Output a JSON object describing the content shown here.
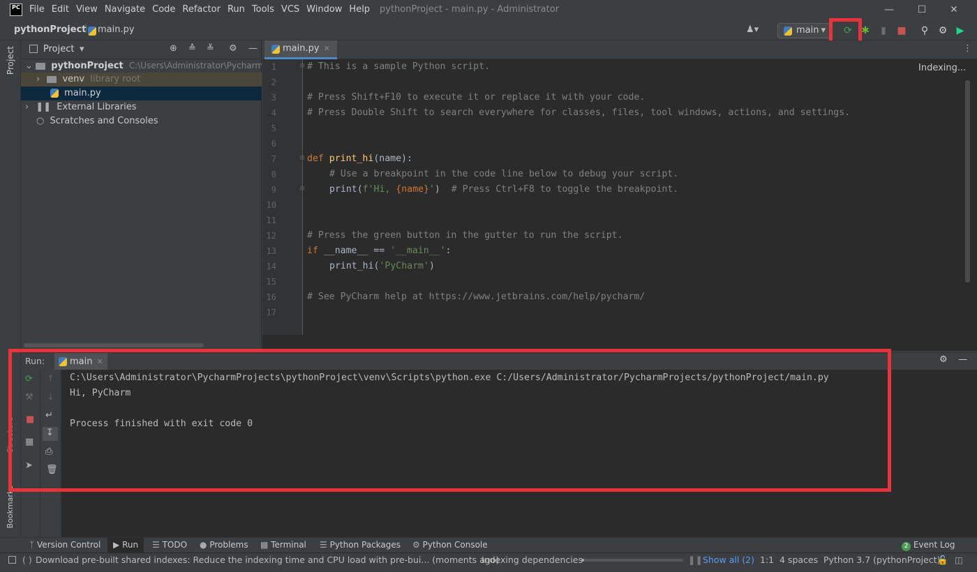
{
  "app": {
    "logo_text": "PC",
    "window_title": "pythonProject - main.py - Administrator"
  },
  "menu": [
    "File",
    "Edit",
    "View",
    "Navigate",
    "Code",
    "Refactor",
    "Run",
    "Tools",
    "VCS",
    "Window",
    "Help"
  ],
  "navbar": {
    "project": "pythonProject",
    "file": "main.py",
    "run_config": "main"
  },
  "project_panel": {
    "title": "Project",
    "stripe_label": "Project",
    "tree": [
      {
        "label": "pythonProject",
        "hint": "C:\\Users\\Administrator\\PycharmProjects\\pythonProject"
      },
      {
        "label": "venv",
        "hint": "library root"
      },
      {
        "label": "main.py",
        "hint": ""
      },
      {
        "label": "External Libraries",
        "hint": ""
      },
      {
        "label": "Scratches and Consoles",
        "hint": ""
      }
    ]
  },
  "editor": {
    "tab": "main.py",
    "status": "Indexing...",
    "line_numbers": [
      "1",
      "2",
      "3",
      "4",
      "5",
      "6",
      "7",
      "8",
      "9",
      "10",
      "11",
      "12",
      "13",
      "14",
      "15",
      "16",
      "17"
    ],
    "lines": {
      "l1": "# This is a sample Python script.",
      "l3": "# Press Shift+F10 to execute it or replace it with your code.",
      "l4": "# Press Double Shift to search everywhere for classes, files, tool windows, actions, and settings.",
      "l7_kw": "def",
      "l7_fn": "print_hi",
      "l7_rest": "(name):",
      "l8": "# Use a breakpoint in the code line below to debug your script.",
      "l9_a": "print(",
      "l9_str1": "f'Hi, ",
      "l9_b": "{name}",
      "l9_str2": "'",
      "l9_c": ")  ",
      "l9_cm": "# Press Ctrl+F8 to toggle the breakpoint.",
      "l12": "# Press the green button in the gutter to run the script.",
      "l13_kw": "if",
      "l13_a": " __name__ == ",
      "l13_str": "'__main__'",
      "l13_b": ":",
      "l14_a": "print_hi(",
      "l14_str": "'PyCharm'",
      "l14_b": ")",
      "l16": "# See PyCharm help at https://www.jetbrains.com/help/pycharm/"
    }
  },
  "run_panel": {
    "label": "Run:",
    "tab": "main",
    "output": [
      "C:\\Users\\Administrator\\PycharmProjects\\pythonProject\\venv\\Scripts\\python.exe C:/Users/Administrator/PycharmProjects/pythonProject/main.py",
      "Hi, PyCharm",
      "",
      "Process finished with exit code 0"
    ],
    "left_stripe_labels": [
      "Structure",
      "Bookmarks"
    ]
  },
  "tool_tabs": [
    "Version Control",
    "Run",
    "TODO",
    "Problems",
    "Terminal",
    "Python Packages",
    "Python Console"
  ],
  "event_log": {
    "count": "2",
    "label": "Event Log"
  },
  "statusbar": {
    "message": "Download pre-built shared indexes: Reduce the indexing time and CPU load with pre-bui... (moments ago)",
    "indexing": "Indexing dependencies",
    "show_all": "Show all (2)",
    "position": "1:1",
    "indent": "4 spaces",
    "interpreter": "Python 3.7 (pythonProject)"
  },
  "colors": {
    "accent_red": "#e8333a",
    "run_green": "#499c54",
    "stop_red": "#c75450",
    "debug_green": "#5fb832"
  }
}
